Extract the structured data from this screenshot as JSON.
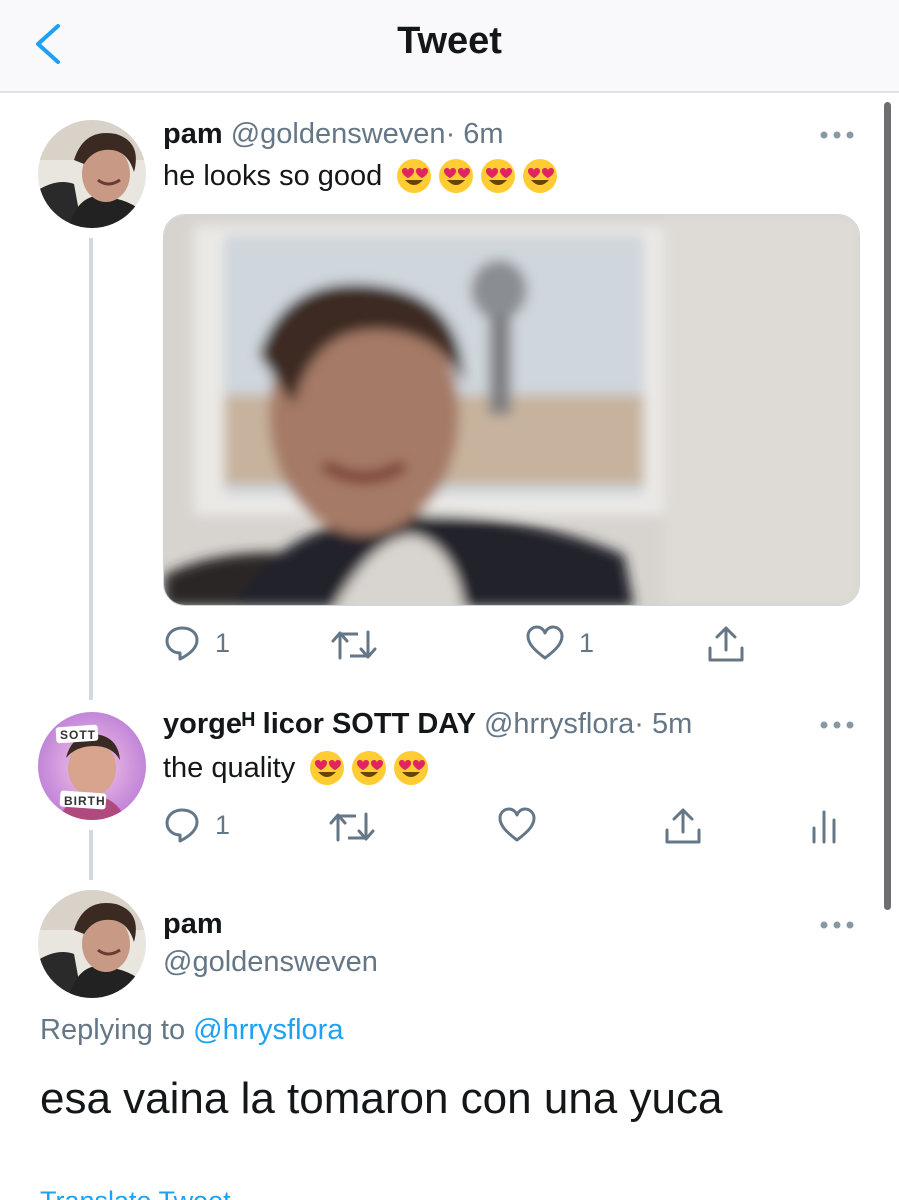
{
  "header": {
    "title": "Tweet"
  },
  "tweets": [
    {
      "name": "pam",
      "handle": "@goldensweven",
      "time": "· 6m",
      "text": "he looks so good",
      "emoji_count": 4,
      "reply_count": "1",
      "like_count": "1"
    },
    {
      "name": "yorgeᴴ licor SOTT DAY",
      "handle": "@hrrysflora",
      "time": "· 5m",
      "text": "the quality",
      "emoji_count": 3,
      "reply_count": "1",
      "avatar_badge_top": "SOTT",
      "avatar_badge_bottom": "BIRTH"
    }
  ],
  "main_tweet": {
    "name": "pam",
    "handle": "@goldensweven",
    "replying_label": "Replying to",
    "replying_handle": "@hrrysflora",
    "text": "esa vaina la tomaron con una yuca",
    "translate_label": "Translate Tweet"
  },
  "colors": {
    "accent": "#1da1f2",
    "secondary_text": "#657786",
    "thread_line": "#cfd9de"
  },
  "icons": [
    "back-chevron-icon",
    "reply-icon",
    "retweet-icon",
    "like-icon",
    "share-icon",
    "analytics-icon",
    "more-icon",
    "heart-eyes-emoji"
  ]
}
